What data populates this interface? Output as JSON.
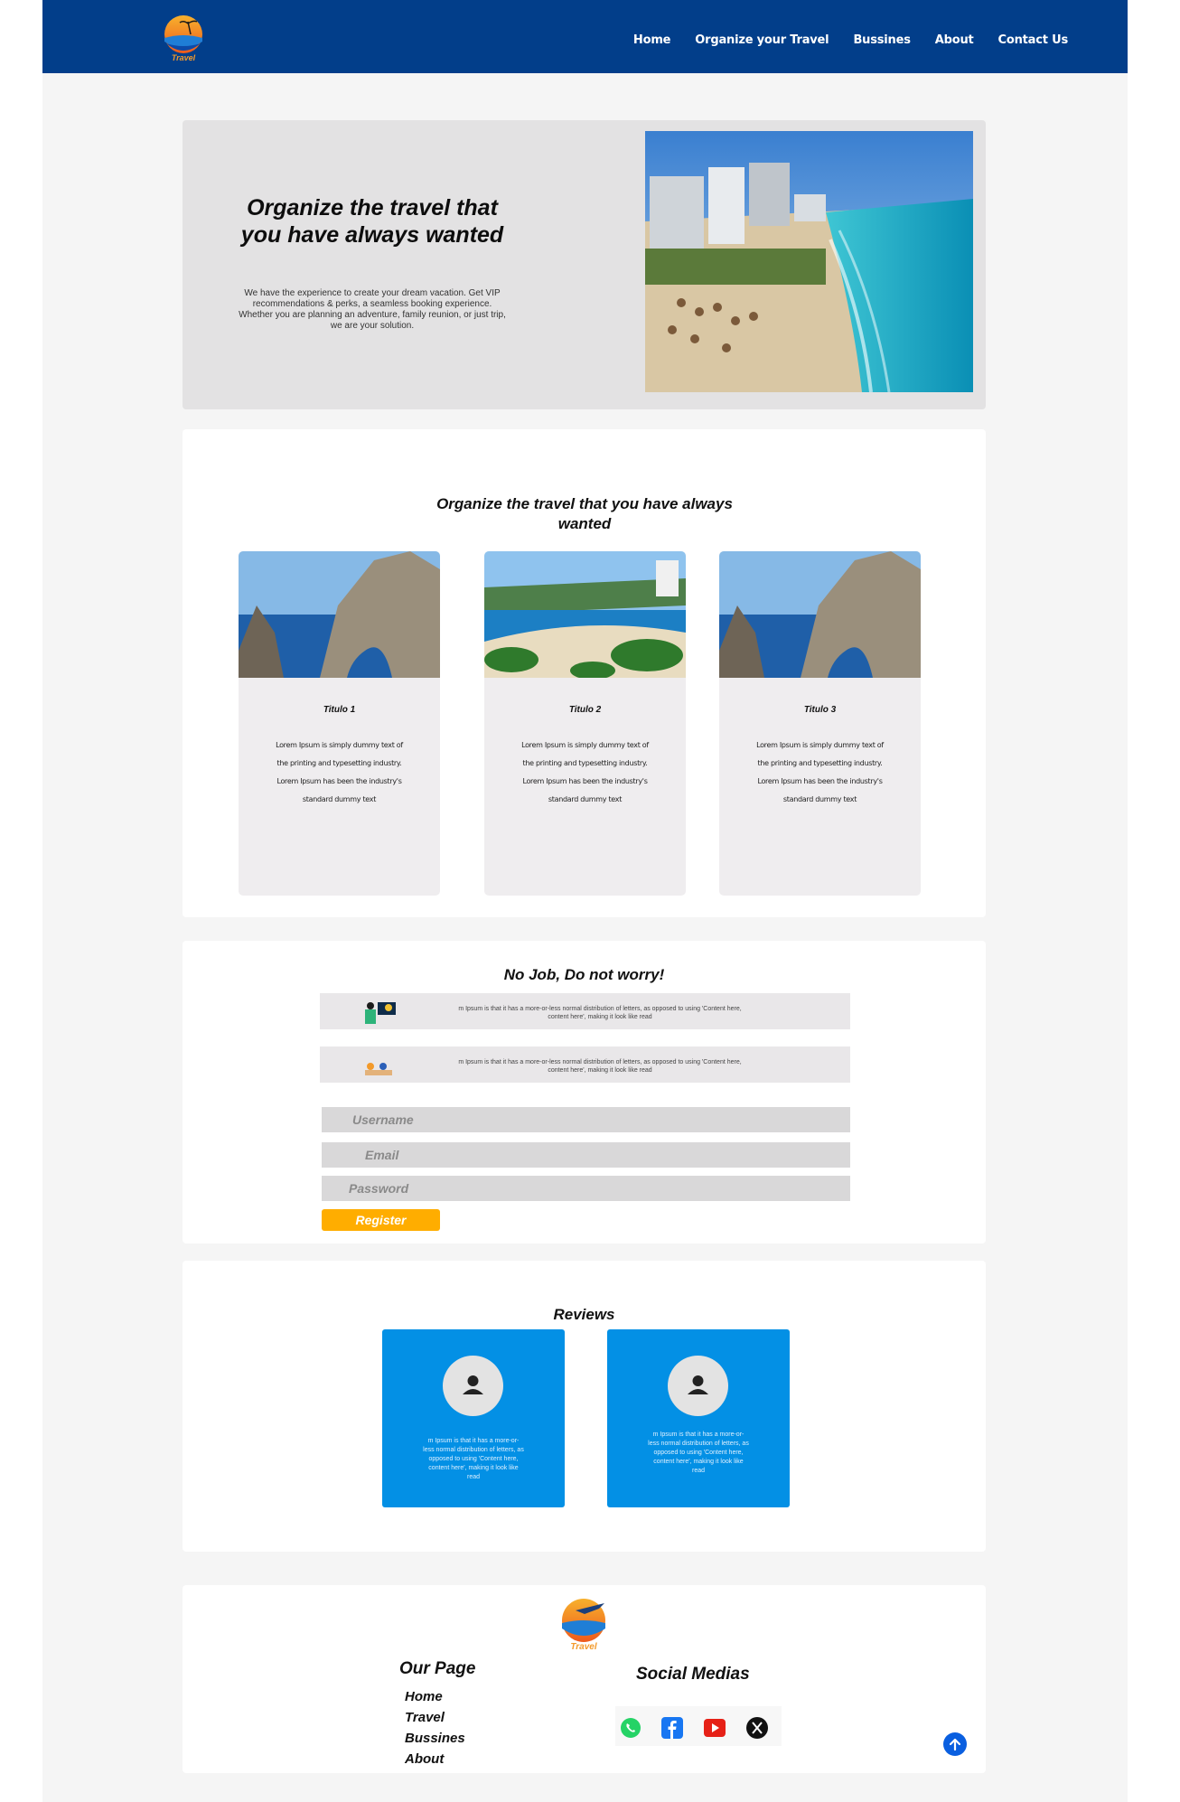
{
  "nav": {
    "logo_text": "Travel",
    "links": [
      "Home",
      "Organize your Travel",
      "Bussines",
      "About",
      "Contact Us"
    ]
  },
  "hero": {
    "title": "Organize the travel that you have always wanted",
    "text": "We have the experience to create your dream vacation. Get VIP recommendations & perks, a seamless booking experience. Whether you are planning an adventure, family reunion, or just trip, we are your solution."
  },
  "destinations": {
    "title": "Organize the travel that you have always wanted",
    "cards": [
      {
        "title": "Titulo 1",
        "text": "Lorem Ipsum is simply dummy text of the printing and typesetting industry. Lorem Ipsum has been the industry's standard dummy text"
      },
      {
        "title": "Titulo 2",
        "text": "Lorem Ipsum is simply dummy text of the printing and typesetting industry. Lorem Ipsum has been the industry's standard dummy text"
      },
      {
        "title": "Titulo 3",
        "text": "Lorem Ipsum is simply dummy text of the printing and typesetting industry. Lorem Ipsum has been the industry's standard dummy text"
      }
    ]
  },
  "job": {
    "title": "No Job, Do not worry!",
    "rows": [
      {
        "text": "m Ipsum is that it has a more-or-less normal distribution of letters, as  opposed to using 'Content here, content here', making it look like read"
      },
      {
        "text": "m Ipsum is that it has a more-or-less normal distribution of letters, as  opposed to using 'Content here, content here', making it look like read"
      }
    ],
    "form": {
      "username_placeholder": "Username",
      "email_placeholder": "Email",
      "password_placeholder": "Password",
      "register_label": "Register"
    }
  },
  "reviews": {
    "title": "Reviews",
    "items": [
      {
        "text": "m Ipsum is that it has a more-or-less normal distribution of letters, as opposed to using 'Content here, content here', making it look like read"
      },
      {
        "text": "m Ipsum is that it has a more-or-less normal distribution of letters, as opposed to using 'Content here, content here', making it look like read"
      }
    ]
  },
  "footer": {
    "logo_text": "Travel",
    "our_page_title": "Our Page",
    "links": [
      "Home",
      "Travel",
      "Bussines",
      "About"
    ],
    "social_title": "Social Medias",
    "social_icons": [
      "whatsapp-icon",
      "facebook-icon",
      "youtube-icon",
      "x-icon"
    ]
  },
  "colors": {
    "nav_bg": "#023e8a",
    "accent_orange": "#ffad00",
    "review_blue": "#0390e5",
    "scroll_top_blue": "#0a5fe0"
  }
}
